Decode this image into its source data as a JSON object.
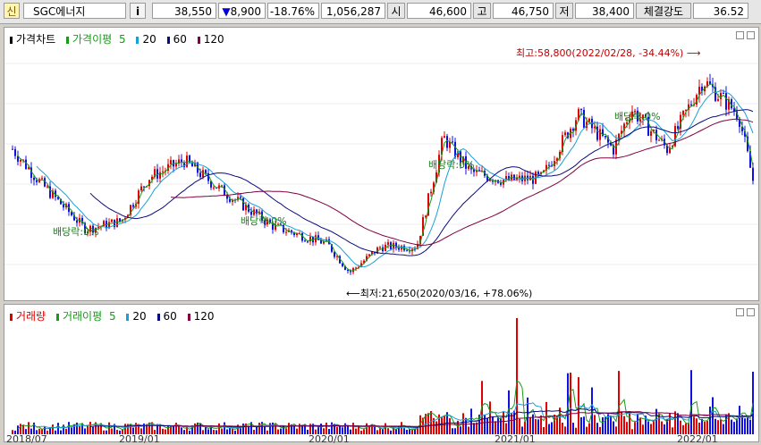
{
  "header": {
    "code_badge": "신",
    "stock_name": "SGC에너지",
    "info_icon": "i",
    "price": "38,550",
    "change_arrow": "▼",
    "change": "8,900",
    "change_pct": "-18.76%",
    "volume": "1,056,287",
    "open_label": "시",
    "open": "46,600",
    "high_label": "고",
    "high": "46,750",
    "low_label": "저",
    "low": "38,400",
    "strength_label": "체결강도",
    "strength": "36.52"
  },
  "price_panel": {
    "legend_title": "가격차트",
    "ma_title": "가격이평",
    "ma_periods": [
      "5",
      "20",
      "60",
      "120"
    ],
    "annotation_high": "최고:58,800(2022/02/28, -34.44%)",
    "annotation_low": "최저:21,650(2020/03/16, +78.06%)",
    "dividend_label": "배당락:0%"
  },
  "volume_panel": {
    "legend_title": "거래량",
    "ma_title": "거래이평",
    "ma_periods": [
      "5",
      "20",
      "60",
      "120"
    ]
  },
  "x_axis_labels": [
    "2018/07",
    "2019/01",
    "2020/01",
    "2021/01",
    "2022/01"
  ],
  "colors": {
    "up": "#e00000",
    "down": "#1010e0",
    "ma5": "#1a9a1a",
    "ma20": "#1aa0d8",
    "ma60": "#0a0a80",
    "ma120": "#800040",
    "annotation": "#c00000"
  },
  "chart_data": {
    "type": "candlestick",
    "high": {
      "value": 58800,
      "date": "2022/02/28",
      "pct": "-34.44%"
    },
    "low": {
      "value": 21650,
      "date": "2020/03/16",
      "pct": "+78.06%"
    },
    "last_close": 38550,
    "ma_periods": [
      5,
      20,
      60,
      120
    ]
  }
}
